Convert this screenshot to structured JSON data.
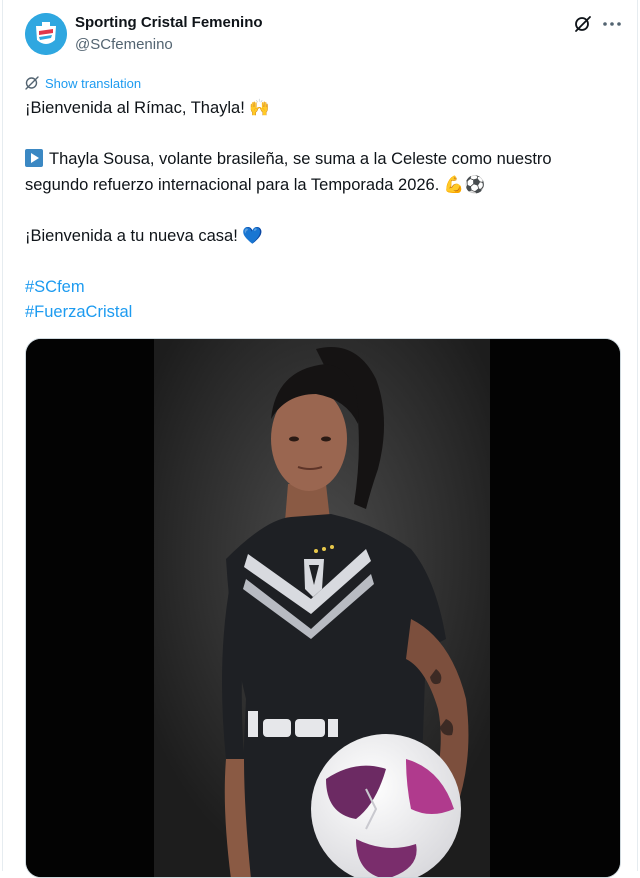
{
  "author": {
    "name": "Sporting Cristal Femenino",
    "handle": "@SCfemenino"
  },
  "translate_link": "Show translation",
  "tweet": {
    "line1": "¡Bienvenida al Rímac, Thayla! 🙌",
    "line2a": "Thayla Sousa, volante brasileña, se suma a la Celeste como nuestro",
    "line2b": "segundo refuerzo internacional para la Temporada 2026. 💪⚽",
    "line3": "¡Bienvenida a tu nueva casa! 💙",
    "hashtags": [
      "#SCfem",
      "#FuerzaCristal"
    ]
  },
  "media": {
    "jersey_sponsor": "tmwin"
  },
  "icons": {
    "grok": "grok-icon",
    "more": "more-options-icon",
    "translate": "translate-icon",
    "play": "play-button-emoji"
  },
  "colors": {
    "link": "#1d9bf0",
    "text": "#0f1419",
    "secondary": "#536471",
    "avatar": "#2fa7e0"
  }
}
